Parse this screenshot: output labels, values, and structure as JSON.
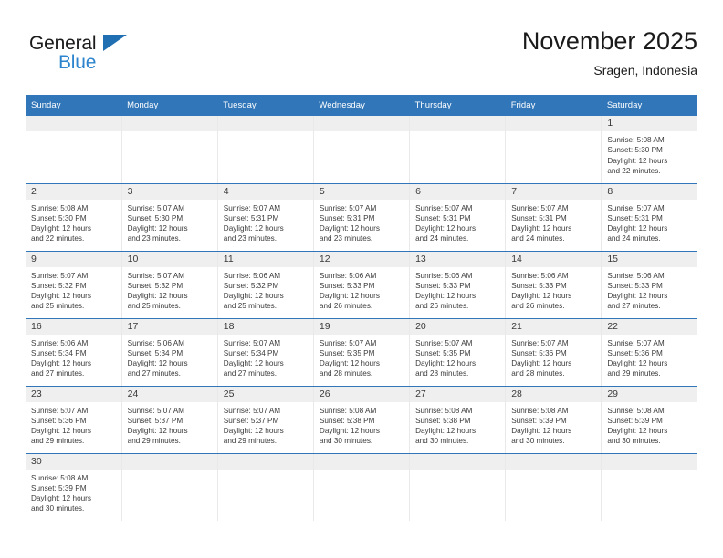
{
  "brand": {
    "name_part1": "General",
    "name_part2": "Blue",
    "flag_icon": "triangle-flag-icon",
    "colors": {
      "dark": "#1a1a1a",
      "blue": "#2b84cd",
      "flag": "#1f6fb2"
    }
  },
  "header": {
    "title": "November 2025",
    "subtitle": "Sragen, Indonesia"
  },
  "theme": {
    "header_blue": "#3176b8",
    "daynum_band": "#efefef",
    "row_separator": "#3176b8",
    "column_separator": "#e9e9e9",
    "text": "#3a3a3a"
  },
  "calendar": {
    "weekdays": [
      "Sunday",
      "Monday",
      "Tuesday",
      "Wednesday",
      "Thursday",
      "Friday",
      "Saturday"
    ],
    "weeks": [
      [
        {
          "day": ""
        },
        {
          "day": ""
        },
        {
          "day": ""
        },
        {
          "day": ""
        },
        {
          "day": ""
        },
        {
          "day": ""
        },
        {
          "day": "1",
          "sunrise": "Sunrise: 5:08 AM",
          "sunset": "Sunset: 5:30 PM",
          "daylight_line1": "Daylight: 12 hours",
          "daylight_line2": "and 22 minutes."
        }
      ],
      [
        {
          "day": "2",
          "sunrise": "Sunrise: 5:08 AM",
          "sunset": "Sunset: 5:30 PM",
          "daylight_line1": "Daylight: 12 hours",
          "daylight_line2": "and 22 minutes."
        },
        {
          "day": "3",
          "sunrise": "Sunrise: 5:07 AM",
          "sunset": "Sunset: 5:30 PM",
          "daylight_line1": "Daylight: 12 hours",
          "daylight_line2": "and 23 minutes."
        },
        {
          "day": "4",
          "sunrise": "Sunrise: 5:07 AM",
          "sunset": "Sunset: 5:31 PM",
          "daylight_line1": "Daylight: 12 hours",
          "daylight_line2": "and 23 minutes."
        },
        {
          "day": "5",
          "sunrise": "Sunrise: 5:07 AM",
          "sunset": "Sunset: 5:31 PM",
          "daylight_line1": "Daylight: 12 hours",
          "daylight_line2": "and 23 minutes."
        },
        {
          "day": "6",
          "sunrise": "Sunrise: 5:07 AM",
          "sunset": "Sunset: 5:31 PM",
          "daylight_line1": "Daylight: 12 hours",
          "daylight_line2": "and 24 minutes."
        },
        {
          "day": "7",
          "sunrise": "Sunrise: 5:07 AM",
          "sunset": "Sunset: 5:31 PM",
          "daylight_line1": "Daylight: 12 hours",
          "daylight_line2": "and 24 minutes."
        },
        {
          "day": "8",
          "sunrise": "Sunrise: 5:07 AM",
          "sunset": "Sunset: 5:31 PM",
          "daylight_line1": "Daylight: 12 hours",
          "daylight_line2": "and 24 minutes."
        }
      ],
      [
        {
          "day": "9",
          "sunrise": "Sunrise: 5:07 AM",
          "sunset": "Sunset: 5:32 PM",
          "daylight_line1": "Daylight: 12 hours",
          "daylight_line2": "and 25 minutes."
        },
        {
          "day": "10",
          "sunrise": "Sunrise: 5:07 AM",
          "sunset": "Sunset: 5:32 PM",
          "daylight_line1": "Daylight: 12 hours",
          "daylight_line2": "and 25 minutes."
        },
        {
          "day": "11",
          "sunrise": "Sunrise: 5:06 AM",
          "sunset": "Sunset: 5:32 PM",
          "daylight_line1": "Daylight: 12 hours",
          "daylight_line2": "and 25 minutes."
        },
        {
          "day": "12",
          "sunrise": "Sunrise: 5:06 AM",
          "sunset": "Sunset: 5:33 PM",
          "daylight_line1": "Daylight: 12 hours",
          "daylight_line2": "and 26 minutes."
        },
        {
          "day": "13",
          "sunrise": "Sunrise: 5:06 AM",
          "sunset": "Sunset: 5:33 PM",
          "daylight_line1": "Daylight: 12 hours",
          "daylight_line2": "and 26 minutes."
        },
        {
          "day": "14",
          "sunrise": "Sunrise: 5:06 AM",
          "sunset": "Sunset: 5:33 PM",
          "daylight_line1": "Daylight: 12 hours",
          "daylight_line2": "and 26 minutes."
        },
        {
          "day": "15",
          "sunrise": "Sunrise: 5:06 AM",
          "sunset": "Sunset: 5:33 PM",
          "daylight_line1": "Daylight: 12 hours",
          "daylight_line2": "and 27 minutes."
        }
      ],
      [
        {
          "day": "16",
          "sunrise": "Sunrise: 5:06 AM",
          "sunset": "Sunset: 5:34 PM",
          "daylight_line1": "Daylight: 12 hours",
          "daylight_line2": "and 27 minutes."
        },
        {
          "day": "17",
          "sunrise": "Sunrise: 5:06 AM",
          "sunset": "Sunset: 5:34 PM",
          "daylight_line1": "Daylight: 12 hours",
          "daylight_line2": "and 27 minutes."
        },
        {
          "day": "18",
          "sunrise": "Sunrise: 5:07 AM",
          "sunset": "Sunset: 5:34 PM",
          "daylight_line1": "Daylight: 12 hours",
          "daylight_line2": "and 27 minutes."
        },
        {
          "day": "19",
          "sunrise": "Sunrise: 5:07 AM",
          "sunset": "Sunset: 5:35 PM",
          "daylight_line1": "Daylight: 12 hours",
          "daylight_line2": "and 28 minutes."
        },
        {
          "day": "20",
          "sunrise": "Sunrise: 5:07 AM",
          "sunset": "Sunset: 5:35 PM",
          "daylight_line1": "Daylight: 12 hours",
          "daylight_line2": "and 28 minutes."
        },
        {
          "day": "21",
          "sunrise": "Sunrise: 5:07 AM",
          "sunset": "Sunset: 5:36 PM",
          "daylight_line1": "Daylight: 12 hours",
          "daylight_line2": "and 28 minutes."
        },
        {
          "day": "22",
          "sunrise": "Sunrise: 5:07 AM",
          "sunset": "Sunset: 5:36 PM",
          "daylight_line1": "Daylight: 12 hours",
          "daylight_line2": "and 29 minutes."
        }
      ],
      [
        {
          "day": "23",
          "sunrise": "Sunrise: 5:07 AM",
          "sunset": "Sunset: 5:36 PM",
          "daylight_line1": "Daylight: 12 hours",
          "daylight_line2": "and 29 minutes."
        },
        {
          "day": "24",
          "sunrise": "Sunrise: 5:07 AM",
          "sunset": "Sunset: 5:37 PM",
          "daylight_line1": "Daylight: 12 hours",
          "daylight_line2": "and 29 minutes."
        },
        {
          "day": "25",
          "sunrise": "Sunrise: 5:07 AM",
          "sunset": "Sunset: 5:37 PM",
          "daylight_line1": "Daylight: 12 hours",
          "daylight_line2": "and 29 minutes."
        },
        {
          "day": "26",
          "sunrise": "Sunrise: 5:08 AM",
          "sunset": "Sunset: 5:38 PM",
          "daylight_line1": "Daylight: 12 hours",
          "daylight_line2": "and 30 minutes."
        },
        {
          "day": "27",
          "sunrise": "Sunrise: 5:08 AM",
          "sunset": "Sunset: 5:38 PM",
          "daylight_line1": "Daylight: 12 hours",
          "daylight_line2": "and 30 minutes."
        },
        {
          "day": "28",
          "sunrise": "Sunrise: 5:08 AM",
          "sunset": "Sunset: 5:39 PM",
          "daylight_line1": "Daylight: 12 hours",
          "daylight_line2": "and 30 minutes."
        },
        {
          "day": "29",
          "sunrise": "Sunrise: 5:08 AM",
          "sunset": "Sunset: 5:39 PM",
          "daylight_line1": "Daylight: 12 hours",
          "daylight_line2": "and 30 minutes."
        }
      ],
      [
        {
          "day": "30",
          "sunrise": "Sunrise: 5:08 AM",
          "sunset": "Sunset: 5:39 PM",
          "daylight_line1": "Daylight: 12 hours",
          "daylight_line2": "and 30 minutes."
        },
        {
          "day": ""
        },
        {
          "day": ""
        },
        {
          "day": ""
        },
        {
          "day": ""
        },
        {
          "day": ""
        },
        {
          "day": ""
        }
      ]
    ]
  }
}
